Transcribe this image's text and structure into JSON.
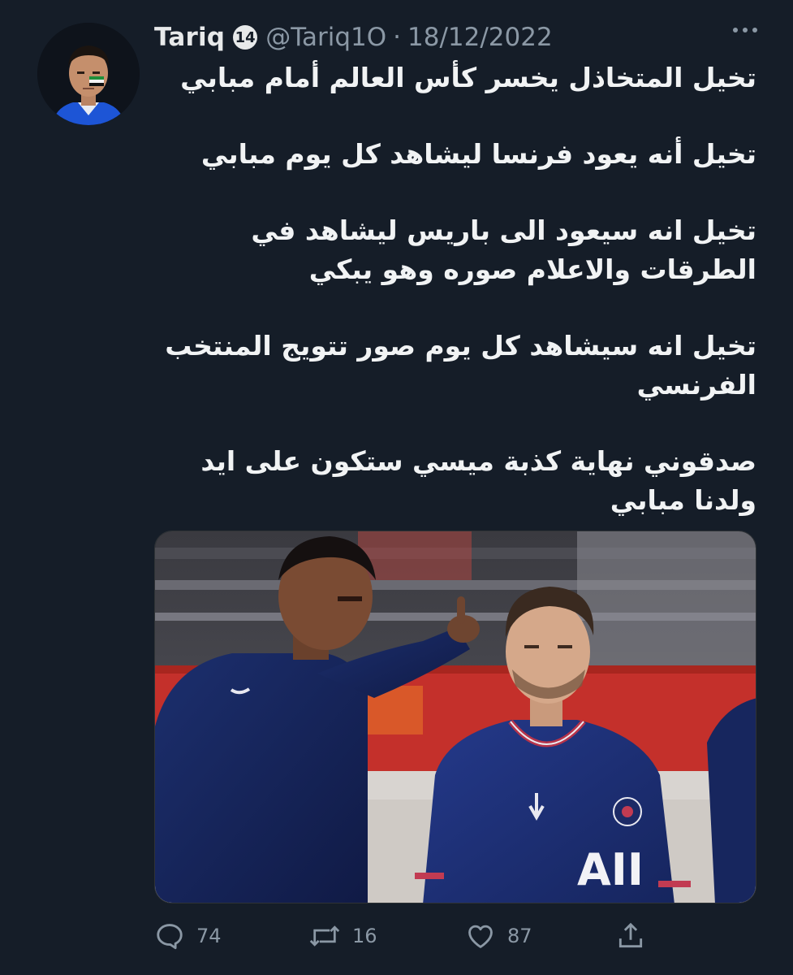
{
  "tweet": {
    "display_name": "Tariq",
    "badge": "14",
    "handle": "@Tariq1O",
    "separator": "·",
    "date": "18/12/2022",
    "paragraphs": [
      "تخيل المتخاذل يخسر كأس العالم أمام مبابي",
      "تخيل أنه يعود فرنسا ليشاهد كل يوم مبابي",
      "تخيل انه سيعود الى باريس ليشاهد في الطرقات والاعلام صوره وهو يبكي",
      "تخيل انه سيشاهد كل يوم صور تتويج المنتخب الفرنسي",
      "صدقوني نهاية كذبة ميسي ستكون على ايد ولدنا مبابي"
    ],
    "media": {
      "jersey_text": "AII"
    }
  },
  "actions": {
    "reply_count": "74",
    "retweet_count": "16",
    "like_count": "87"
  },
  "icons": {
    "more": "more-dots-icon",
    "reply": "reply-bubble-icon",
    "retweet": "retweet-arrows-icon",
    "like": "heart-icon",
    "share": "share-upload-icon"
  },
  "colors": {
    "background": "#151d28",
    "text": "#e7e9ea",
    "muted": "#8b98a5"
  }
}
